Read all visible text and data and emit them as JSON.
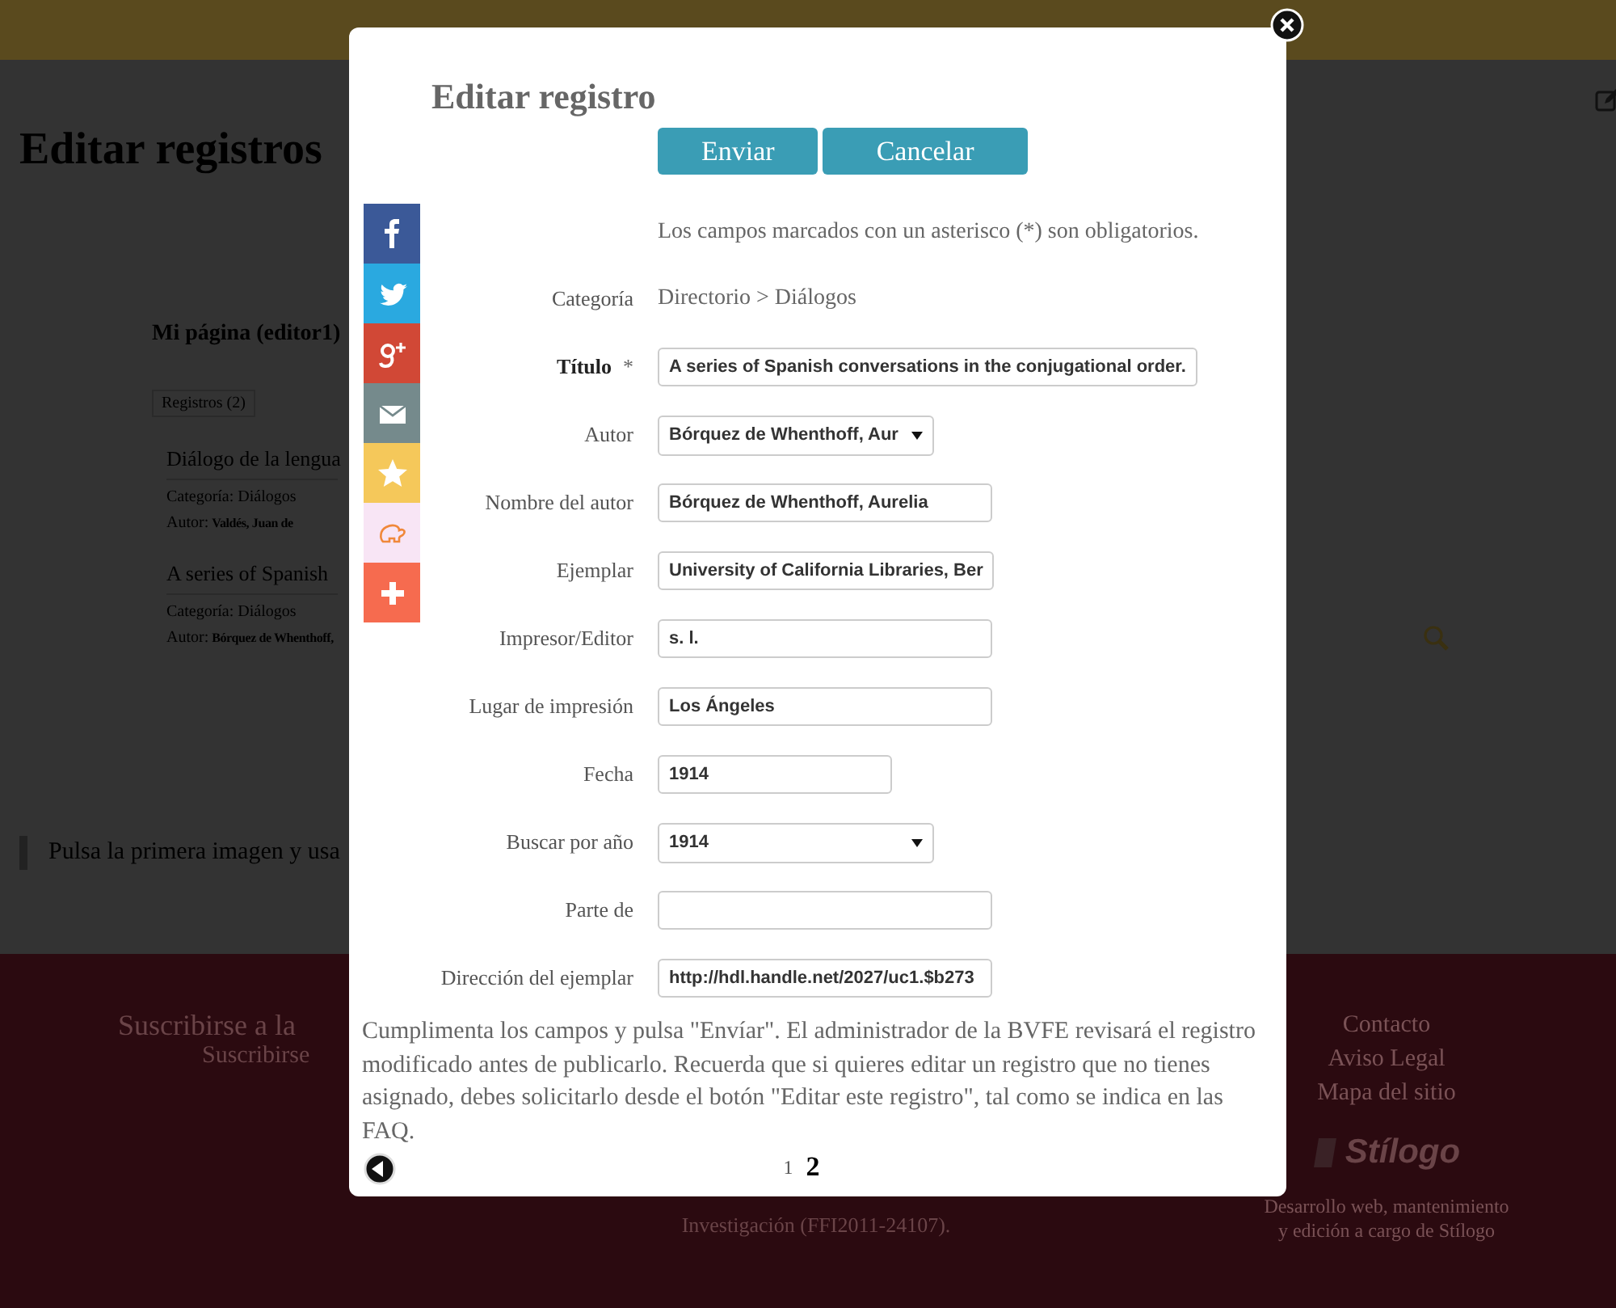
{
  "page": {
    "title": "Editar registros",
    "section_title": "Mi página (editor1)",
    "tab": "Registros (2)",
    "records": [
      {
        "title": "Diálogo de la lengua",
        "category_label": "Categoría:",
        "category": "Diálogos",
        "author_label": "Autor:",
        "author": "Valdés, Juan de"
      },
      {
        "title": "A series of Spanish",
        "category_label": "Categoría:",
        "category": "Diálogos",
        "author_label": "Autor:",
        "author": "Bórquez de Whenthoff,"
      }
    ],
    "hint": "Pulsa la primera imagen y usa"
  },
  "footer": {
    "subscribe_title": "Suscribirse a la",
    "subscribe_link": "Suscribirse",
    "funding": [
      "Investigación (FFI2011-24107)."
    ],
    "links": [
      "Contacto",
      "Aviso Legal",
      "Mapa del sitio"
    ],
    "logo": "Stílogo",
    "credits": [
      "Desarrollo web, mantenimiento",
      "y edición a cargo de Stílogo"
    ]
  },
  "modal": {
    "title": "Editar registro",
    "buttons": [
      "Enviar",
      "Cancelar"
    ],
    "note": "Los campos marcados con un asterisco (*) son obligatorios.",
    "fields": [
      {
        "kind": "static",
        "label": "Categoría",
        "value": "Directorio > Diálogos",
        "required": false
      },
      {
        "kind": "text",
        "label": "Título",
        "value": "A series of Spanish conversations in the conjugational order.",
        "required": true,
        "required_mark": "*"
      },
      {
        "kind": "select",
        "label": "Autor",
        "value": "Bórquez de Whenthoff, Aur",
        "required": false
      },
      {
        "kind": "text",
        "label": "Nombre del autor",
        "value": "Bórquez de Whenthoff, Aurelia",
        "required": false
      },
      {
        "kind": "text",
        "label": "Ejemplar",
        "value": "University of California Libraries, Ber",
        "required": false
      },
      {
        "kind": "text",
        "label": "Impresor/Editor",
        "value": "s. l.",
        "required": false
      },
      {
        "kind": "text",
        "label": "Lugar de impresión",
        "value": "Los Ángeles",
        "required": false
      },
      {
        "kind": "text",
        "label": "Fecha",
        "value": "1914",
        "required": false
      },
      {
        "kind": "select",
        "label": "Buscar por año",
        "value": "1914",
        "required": false
      },
      {
        "kind": "text",
        "label": "Parte de",
        "required": false
      },
      {
        "kind": "text",
        "label": "Dirección del ejemplar",
        "value": "http://hdl.handle.net/2027/uc1.$b273",
        "required": false
      }
    ],
    "info": "Cumplimenta los campos y pulsa \"Envíar\". El administrador de la BVFE revisará el registro modificado antes de publicarlo. Recuerda que si quieres editar un registro que no tienes asignado, debes solicitarlo desde el botón \"Editar este registro\", tal como se indica en las FAQ.",
    "pages": [
      {
        "label": "1",
        "selected": false
      },
      {
        "label": "2",
        "selected": true
      }
    ]
  },
  "share": [
    {
      "kind": "facebook",
      "color": "#3b5998"
    },
    {
      "kind": "twitter",
      "color": "#2aa9e0"
    },
    {
      "kind": "googleplus",
      "color": "#d14836"
    },
    {
      "kind": "email",
      "color": "#758a8c"
    },
    {
      "kind": "favorite",
      "color": "#f5c85a"
    },
    {
      "kind": "elephant",
      "color": "#f8e5f5"
    },
    {
      "kind": "more",
      "color": "#f66b4f"
    }
  ]
}
